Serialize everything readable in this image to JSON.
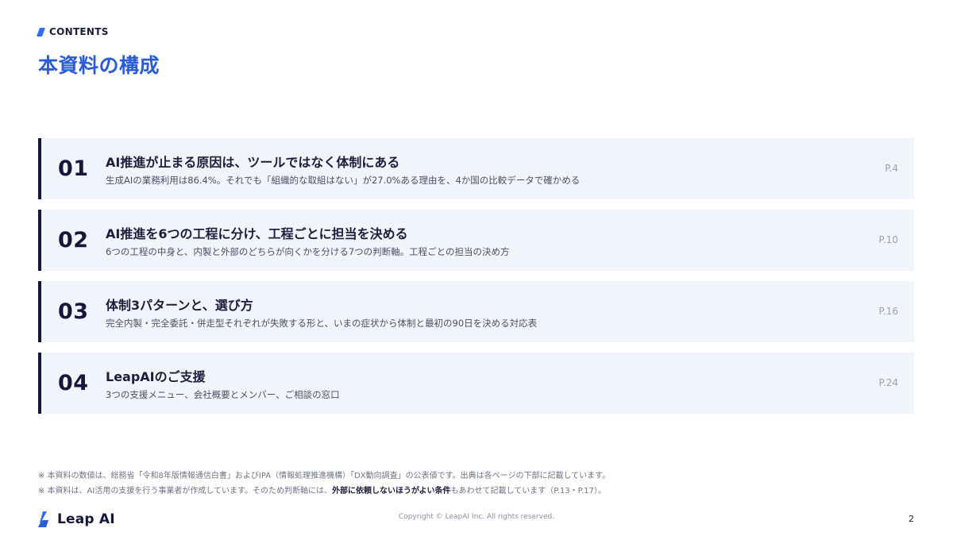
{
  "header": {
    "eyebrow": "CONTENTS",
    "title": "本資料の構成"
  },
  "toc": [
    {
      "num": "01",
      "title": "AI推進が止まる原因は、ツールではなく体制にある",
      "desc": "生成AIの業務利用は86.4%。それでも「組織的な取組はない」が27.0%ある理由を、4か国の比較データで確かめる",
      "page": "P.4"
    },
    {
      "num": "02",
      "title": "AI推進を6つの工程に分け、工程ごとに担当を決める",
      "desc": "6つの工程の中身と、内製と外部のどちらが向くかを分ける7つの判断軸。工程ごとの担当の決め方",
      "page": "P.10"
    },
    {
      "num": "03",
      "title": "体制3パターンと、選び方",
      "desc": "完全内製・完全委託・併走型それぞれが失敗する形と、いまの症状から体制と最初の90日を決める対応表",
      "page": "P.16"
    },
    {
      "num": "04",
      "title": "LeapAIのご支援",
      "desc": "3つの支援メニュー、会社概要とメンバー、ご相談の窓口",
      "page": "P.24"
    }
  ],
  "notes": {
    "line1": "※ 本資料の数値は、総務省「令和8年版情報通信白書」およびIPA（情報処理推進機構）「DX動向調査」の公表値です。出典は各ページの下部に記載しています。",
    "line2_before": "※ 本資料は、AI活用の支援を行う事業者が作成しています。そのため判断軸には、",
    "line2_strong": "外部に依頼しないほうがよい条件",
    "line2_after": "もあわせて記載しています（P.13・P.17）。"
  },
  "footer": {
    "logo_text": "Leap AI",
    "copyright": "Copyright © LeapAI Inc. All rights reserved.",
    "page_number": "2"
  },
  "colors": {
    "accent": "#2a5bd7",
    "navy": "#14173a",
    "row_bg": "#f2f4fb"
  }
}
